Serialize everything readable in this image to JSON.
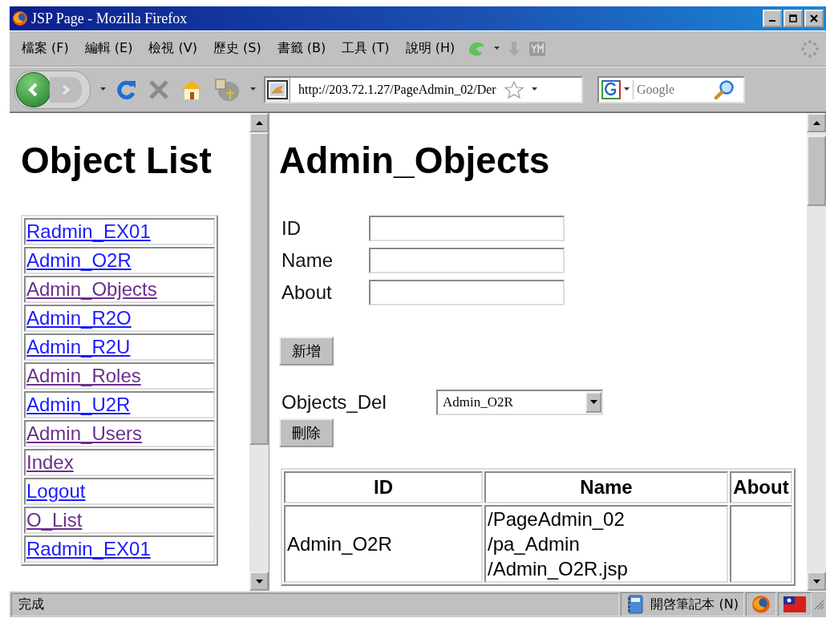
{
  "window": {
    "title": "JSP Page - Mozilla Firefox"
  },
  "menu": [
    "檔案 (F)",
    "編輯 (E)",
    "檢視 (V)",
    "歷史 (S)",
    "書籤 (B)",
    "工具 (T)",
    "說明 (H)"
  ],
  "toolbar": {
    "url": "http://203.72.1.27/PageAdmin_02/Der",
    "search": {
      "placeholder": "Google"
    }
  },
  "sidebar": {
    "title": "Object List",
    "links": [
      {
        "label": "Radmin_EX01",
        "visited": false
      },
      {
        "label": "Admin_O2R",
        "visited": false
      },
      {
        "label": "Admin_Objects",
        "visited": true
      },
      {
        "label": "Admin_R2O",
        "visited": false
      },
      {
        "label": "Admin_R2U",
        "visited": false
      },
      {
        "label": "Admin_Roles",
        "visited": true
      },
      {
        "label": "Admin_U2R",
        "visited": false
      },
      {
        "label": "Admin_Users",
        "visited": true
      },
      {
        "label": "Index",
        "visited": true
      },
      {
        "label": "Logout",
        "visited": false
      },
      {
        "label": "O_List",
        "visited": true
      },
      {
        "label": "Radmin_EX01",
        "visited": false
      }
    ]
  },
  "main": {
    "title": "Admin_Objects",
    "fields": [
      {
        "label": "ID"
      },
      {
        "label": "Name"
      },
      {
        "label": "About"
      }
    ],
    "add_button": "新增",
    "delete": {
      "label": "Objects_Del",
      "value": "Admin_O2R",
      "button": "刪除"
    },
    "table": {
      "columns": [
        "ID",
        "Name",
        "About"
      ],
      "rows": [
        {
          "cells": [
            "Admin_O2R",
            "/PageAdmin_02/pa_Admin/Admin_O2R.jsp"
          ]
        }
      ]
    }
  },
  "status_bar": {
    "text": "完成",
    "notes": "開啓筆記本 (N)"
  }
}
